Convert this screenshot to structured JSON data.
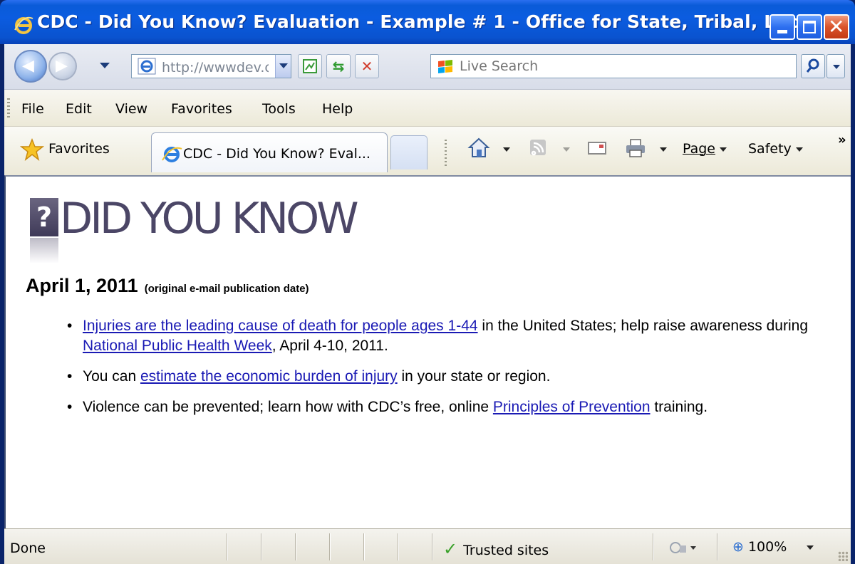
{
  "window": {
    "title": "CDC - Did You Know? Evaluation - Example # 1 - Office for State, Tribal, Local ..."
  },
  "address_bar": {
    "url": "http://wwwdev.c"
  },
  "search": {
    "placeholder": "Live Search"
  },
  "menu": {
    "items": [
      "File",
      "Edit",
      "View",
      "Favorites",
      "Tools",
      "Help"
    ]
  },
  "favorites_bar": {
    "favorites_label": "Favorites",
    "tab_title": "CDC - Did You Know? Eval...",
    "page_label": "Page",
    "safety_label": "Safety"
  },
  "content": {
    "logo_text": "DID YOU KNOW",
    "logo_mark": "?",
    "date": "April 1, 2011",
    "date_note": "(original e-mail publication date)",
    "bullets": [
      {
        "link": "Injuries are the leading cause of death for people ages 1-44",
        "text_after": " in the United States; help raise awareness during ",
        "link2": "National Public Health Week",
        "text_end": ", April 4-10, 2011."
      },
      {
        "text_before": "You can ",
        "link": "estimate the economic burden of injury",
        "text_after": " in your state or region."
      },
      {
        "text_before": "Violence can be prevented; learn how with CDC’s free, online ",
        "link": "Principles of Prevention",
        "text_after": " training."
      }
    ]
  },
  "status_bar": {
    "status": "Done",
    "zone": "Trusted sites",
    "zoom": "100%"
  },
  "colors": {
    "title_bar": "#0a5bd8",
    "link": "#1a1ab4",
    "logo": "#4b4666"
  }
}
